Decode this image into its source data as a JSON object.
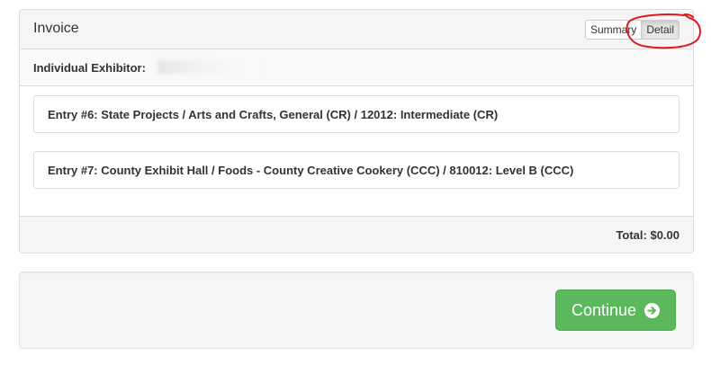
{
  "invoice": {
    "title": "Invoice",
    "view_toggle": {
      "summary_label": "Summary",
      "detail_label": "Detail",
      "selected": "Detail"
    },
    "exhibitor_label": "Individual Exhibitor:",
    "entries": [
      {
        "text": "Entry #6: State Projects / Arts and Crafts, General (CR) / 12012: Intermediate (CR)"
      },
      {
        "text": "Entry #7: County Exhibit Hall / Foods - County Creative Cookery (CCC) / 810012: Level B (CCC)"
      }
    ],
    "total": "Total: $0.00"
  },
  "actions": {
    "continue_label": "Continue"
  },
  "colors": {
    "continue_button": "#5cb85c",
    "annotation": "#e0191f"
  },
  "icons": {
    "continue": "arrow-circle-right-icon"
  }
}
